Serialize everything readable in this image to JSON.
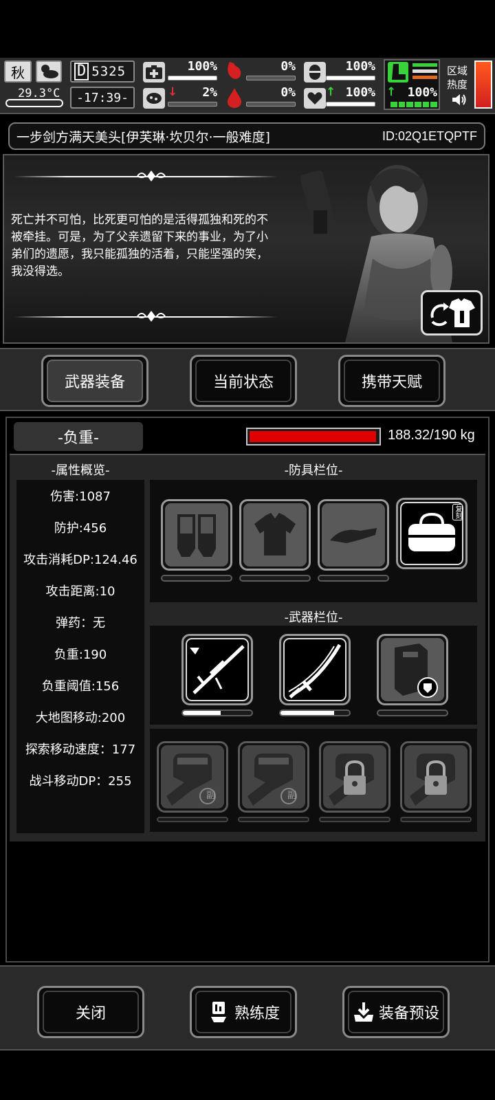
{
  "hud": {
    "season": "秋",
    "temperature": "29.3°C",
    "day_counter": "5325",
    "day_prefix": "D",
    "clock": "-17:39-",
    "health_pct": "100%",
    "hunger_pct": "0%",
    "armor_pct": "100%",
    "infection_pct": "2%",
    "bleed_pct": "0%",
    "mood_pct": "100%",
    "stamina_pct": "100%",
    "zone_heat_label_1": "区域",
    "zone_heat_label_2": "热度",
    "accent_green": "#39d23a",
    "accent_red": "#e03030"
  },
  "title": {
    "text": "一步剑方满天美头[伊芙琳·坎贝尔·一般难度]",
    "id": "ID:02Q1ETQPTF"
  },
  "story": {
    "text": "死亡并不可怕，比死更可怕的是活得孤独和死的不被牵挂。可是，为了父亲遗留下来的事业，为了小弟们的遗愿，我只能孤独的活着，只能坚强的笑，我没得选。"
  },
  "tabs": [
    {
      "label": "武器装备",
      "active": true
    },
    {
      "label": "当前状态",
      "active": false
    },
    {
      "label": "携带天赋",
      "active": false
    }
  ],
  "weight": {
    "label": "-负重-",
    "value_text": "188.32/190 kg",
    "fraction": 0.991,
    "bar_color": "#e00000"
  },
  "attributes": {
    "title": "-属性概览-",
    "items": [
      "伤害:1087",
      "防护:456",
      "攻击消耗DP:124.46",
      "攻击距离:10",
      "弹药：无",
      "负重:190",
      "负重阈值:156",
      "大地图移动:200",
      "探索移动速度：177",
      "战斗移动DP：255"
    ]
  },
  "armor": {
    "title": "-防具栏位-",
    "slots": [
      {
        "icon": "gloves-icon",
        "durability": 0
      },
      {
        "icon": "shirt-icon",
        "durability": 0
      },
      {
        "icon": "visor-cap-icon",
        "durability": 0
      },
      {
        "icon": "duffel-bag-icon",
        "badge": "复刻",
        "durability": null
      }
    ]
  },
  "weapons": {
    "title": "-武器栏位-",
    "slots": [
      {
        "icon": "sniper-rifle-icon",
        "durability": 0.55
      },
      {
        "icon": "katana-icon",
        "durability": 0.78
      },
      {
        "icon": "riot-shield-icon",
        "durability": 0
      }
    ],
    "fist_slots": [
      {
        "icon": "fist-icon",
        "badge": "副",
        "locked": false
      },
      {
        "icon": "fist-icon",
        "badge": "副",
        "locked": false
      },
      {
        "icon": "fist-icon",
        "locked": true
      },
      {
        "icon": "fist-icon",
        "locked": true
      }
    ]
  },
  "bottom": {
    "close": "关闭",
    "proficiency": "熟练度",
    "preset": "装备预设"
  }
}
